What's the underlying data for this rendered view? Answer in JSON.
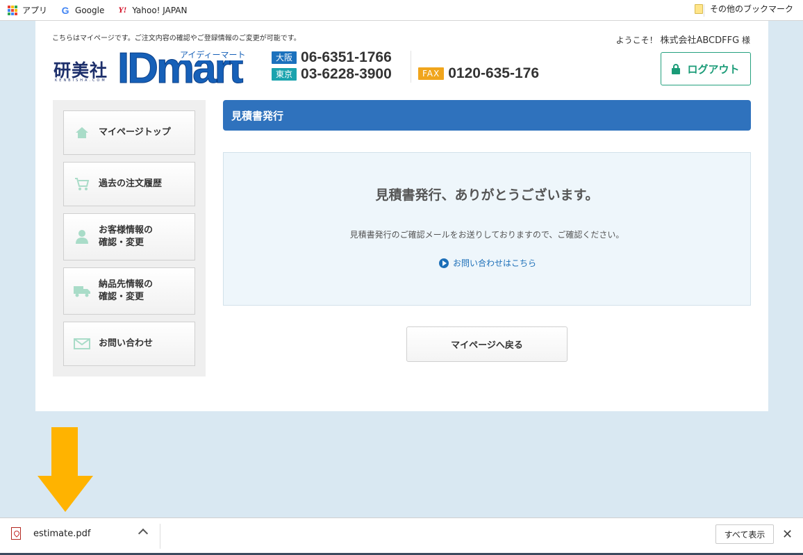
{
  "bookmarks": {
    "apps_label": "アプリ",
    "google_label": "Google",
    "yahoo_label": "Yahoo! JAPAN",
    "other_label": "その他のブックマーク"
  },
  "header": {
    "note": "こちらはマイページです。ご注文内容の確認やご登録情報のご変更が可能です。",
    "welcome_prefix": "ようこそ！",
    "user_name": "株式会社ABCDFFG",
    "welcome_suffix": "様",
    "logo": {
      "kanji": "研美社",
      "kanji_sub": "KENBISHA.COM",
      "brand": "IDmart",
      "kana": "アイディーマート"
    },
    "phones": {
      "osaka_tag": "大阪",
      "osaka_number": "06-6351-1766",
      "tokyo_tag": "東京",
      "tokyo_number": "03-6228-3900",
      "fax_tag": "FAX",
      "fax_number": "0120-635-176"
    },
    "logout_label": "ログアウト"
  },
  "sidebar": {
    "items": [
      {
        "label": "マイページトップ",
        "icon": "home-icon"
      },
      {
        "label": "過去の注文履歴",
        "icon": "cart-icon"
      },
      {
        "label1": "お客様情報の",
        "label2": "確認・変更",
        "icon": "user-icon"
      },
      {
        "label1": "納品先情報の",
        "label2": "確認・変更",
        "icon": "truck-icon"
      },
      {
        "label": "お問い合わせ",
        "icon": "mail-icon"
      }
    ]
  },
  "main": {
    "title": "見積書発行",
    "thanks_heading": "見積書発行、ありがとうございます。",
    "thanks_text": "見積書発行のご確認メールをお送りしておりますので、ご確認ください。",
    "inquiry_link": "お問い合わせはこちら",
    "back_button": "マイページへ戻る"
  },
  "downloads": {
    "file_name": "estimate.pdf",
    "show_all": "すべて表示",
    "close": "✕"
  },
  "colors": {
    "accent_blue": "#2f72bd",
    "logout_green": "#1a9b77",
    "arrow_orange": "#ffb300"
  }
}
